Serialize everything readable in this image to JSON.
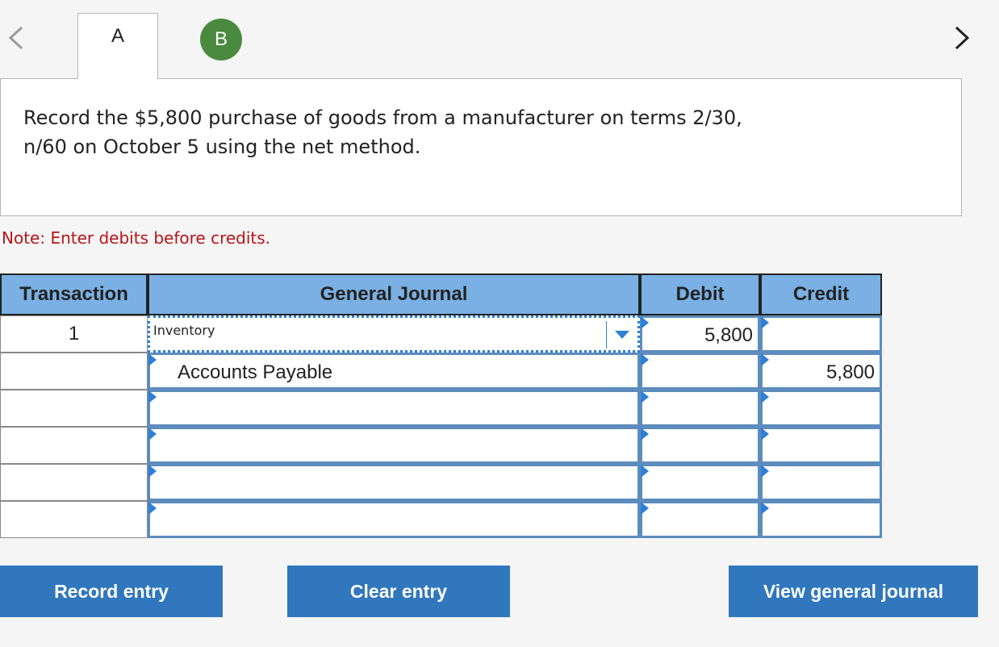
{
  "tabs": [
    {
      "label": "A"
    },
    {
      "label": "B",
      "status_color": "#4a8a3f"
    }
  ],
  "nav": {
    "prev_icon": "chevron-left-icon",
    "next_icon": "chevron-right-icon"
  },
  "prompt": {
    "line1": "Record the $5,800 purchase of goods from a manufacturer on terms 2/30,",
    "line2": "n/60 on October 5 using the net method."
  },
  "note": "Note: Enter debits before credits.",
  "journal": {
    "headers": {
      "transaction": "Transaction",
      "general_journal": "General Journal",
      "debit": "Debit",
      "credit": "Credit"
    },
    "rows": [
      {
        "transaction": "1",
        "account": "Inventory",
        "debit": "5,800",
        "credit": ""
      },
      {
        "transaction": "",
        "account": "Accounts Payable",
        "debit": "",
        "credit": "5,800"
      },
      {
        "transaction": "",
        "account": "",
        "debit": "",
        "credit": ""
      },
      {
        "transaction": "",
        "account": "",
        "debit": "",
        "credit": ""
      },
      {
        "transaction": "",
        "account": "",
        "debit": "",
        "credit": ""
      },
      {
        "transaction": "",
        "account": "",
        "debit": "",
        "credit": ""
      }
    ]
  },
  "buttons": {
    "record": "Record entry",
    "clear": "Clear entry",
    "view": "View general journal"
  },
  "colors": {
    "header_bg": "#7ab0e3",
    "button_bg": "#3177bd",
    "note": "#b8141a",
    "accent": "#2e7fd6"
  }
}
